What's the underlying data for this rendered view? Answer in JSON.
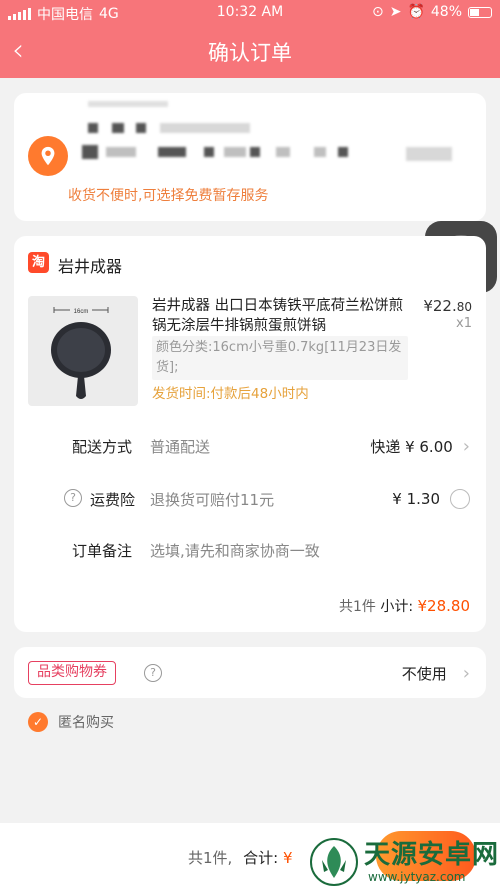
{
  "status_bar": {
    "carrier": "中国电信",
    "network": "4G",
    "time": "10:32 AM",
    "battery": "48%"
  },
  "nav": {
    "back_icon": "chevron-left-icon",
    "title": "确认订单"
  },
  "address": {
    "icon": "location-pin-icon",
    "hint": "收货不便时,可选择免费暂存服务"
  },
  "shop": {
    "icon_label": "淘",
    "name": "岩井成器"
  },
  "product": {
    "image_label": "16cm",
    "title": "岩井成器 出口日本铸铁平底荷兰松饼煎锅无涂层牛排锅煎蛋煎饼锅",
    "spec": "颜色分类:16cm小号重0.7kg[11月23日发货];",
    "ship_time": "发货时间:付款后48小时内",
    "price_main": "¥22.",
    "price_cents": "80",
    "qty": "x1"
  },
  "delivery": {
    "label": "配送方式",
    "value": "普通配送",
    "price": "快递 ¥ 6.00"
  },
  "insurance": {
    "label": "运费险",
    "value": "退换货可赔付11元",
    "price": "¥ 1.30"
  },
  "note": {
    "label": "订单备注",
    "placeholder": "选填,请先和商家协商一致"
  },
  "subtotal": {
    "count": "共1件",
    "label": "小计:",
    "amount": "¥28.80"
  },
  "coupon": {
    "tag": "品类购物券",
    "value": "不使用"
  },
  "anonymous": {
    "label": "匿名购买",
    "checked": true
  },
  "bottom": {
    "count": "共1件,",
    "total_label": "合计:",
    "currency": "¥"
  },
  "watermark": {
    "text": "天源安卓网",
    "url": "www.jytyaz.com"
  },
  "colors": {
    "nav_bg": "#f7757a",
    "accent": "#ff5000",
    "location": "#ff7a2e",
    "coupon": "#e64060"
  }
}
